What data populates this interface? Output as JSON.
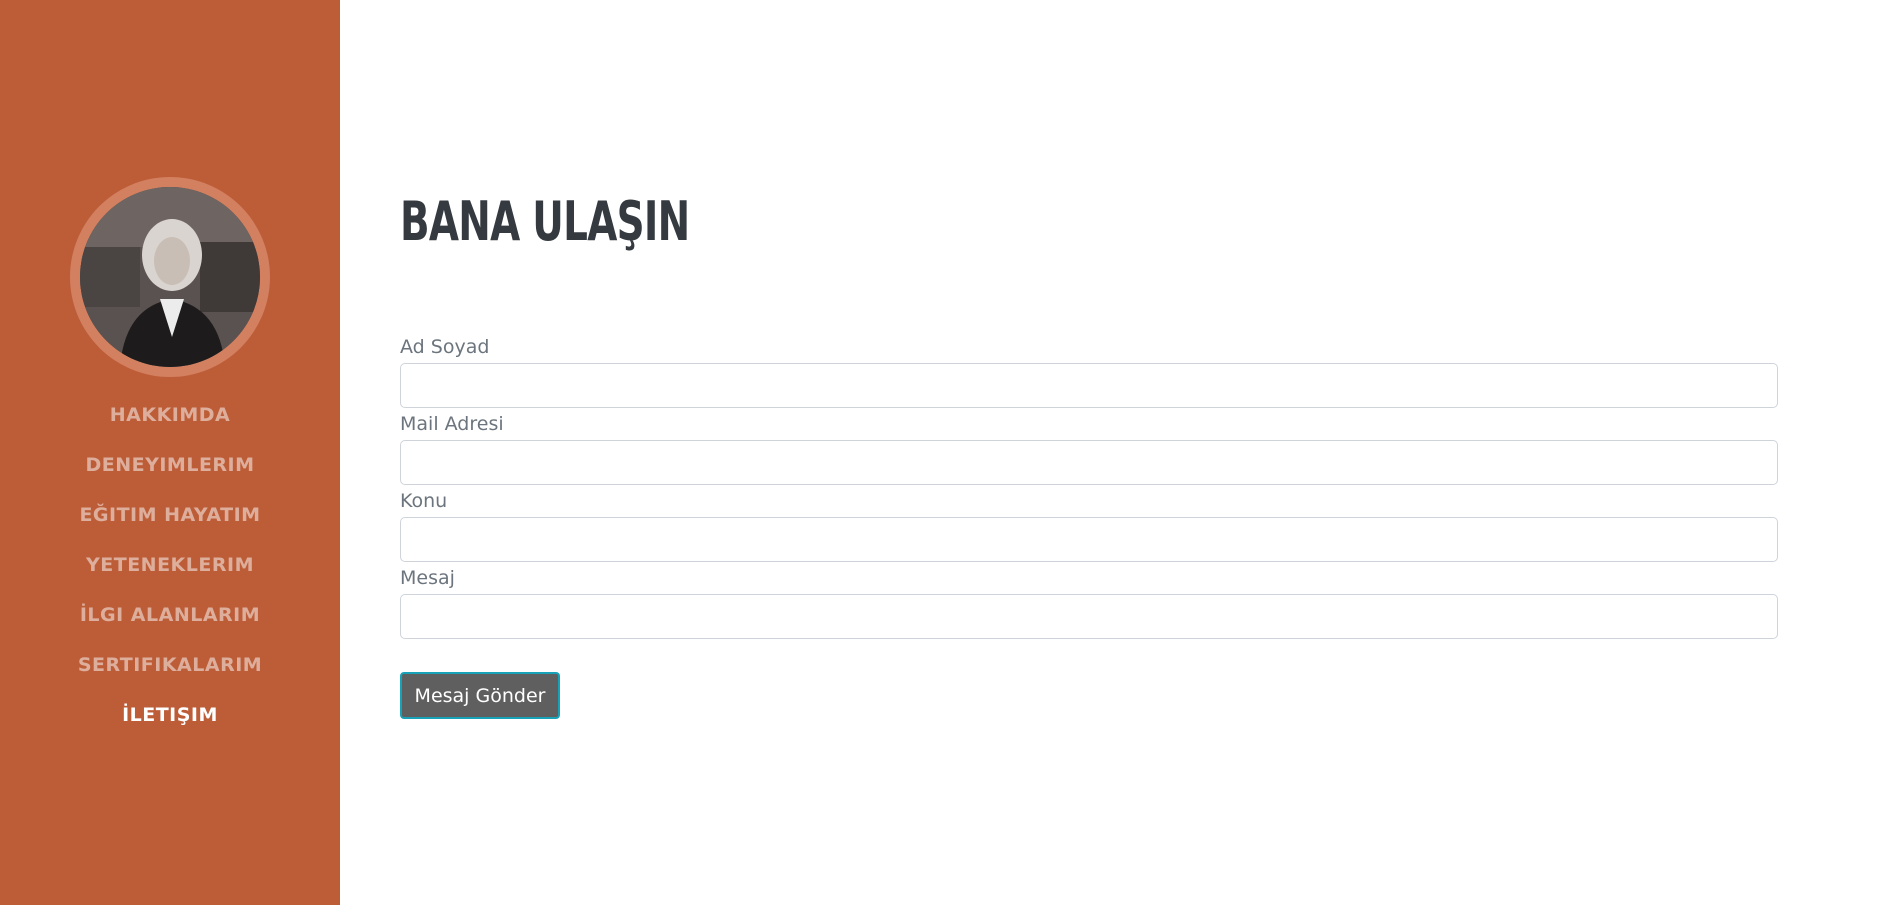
{
  "sidebar": {
    "nav": [
      {
        "label": "HAKKIMDA",
        "active": false
      },
      {
        "label": "DENEYIMLERIM",
        "active": false
      },
      {
        "label": "EĞITIM HAYATIM",
        "active": false
      },
      {
        "label": "YETENEKLERIM",
        "active": false
      },
      {
        "label": "İLGI ALANLARIM",
        "active": false
      },
      {
        "label": "SERTIFIKALARIM",
        "active": false
      },
      {
        "label": "İLETIŞIM",
        "active": true
      }
    ],
    "background_color": "#bd5d38"
  },
  "main": {
    "title": "BANA ULAŞIN",
    "form": {
      "fields": [
        {
          "label": "Ad Soyad",
          "value": ""
        },
        {
          "label": "Mail Adresi",
          "value": ""
        },
        {
          "label": "Konu",
          "value": ""
        },
        {
          "label": "Mesaj",
          "value": ""
        }
      ],
      "submit_label": "Mesaj Gönder"
    }
  }
}
